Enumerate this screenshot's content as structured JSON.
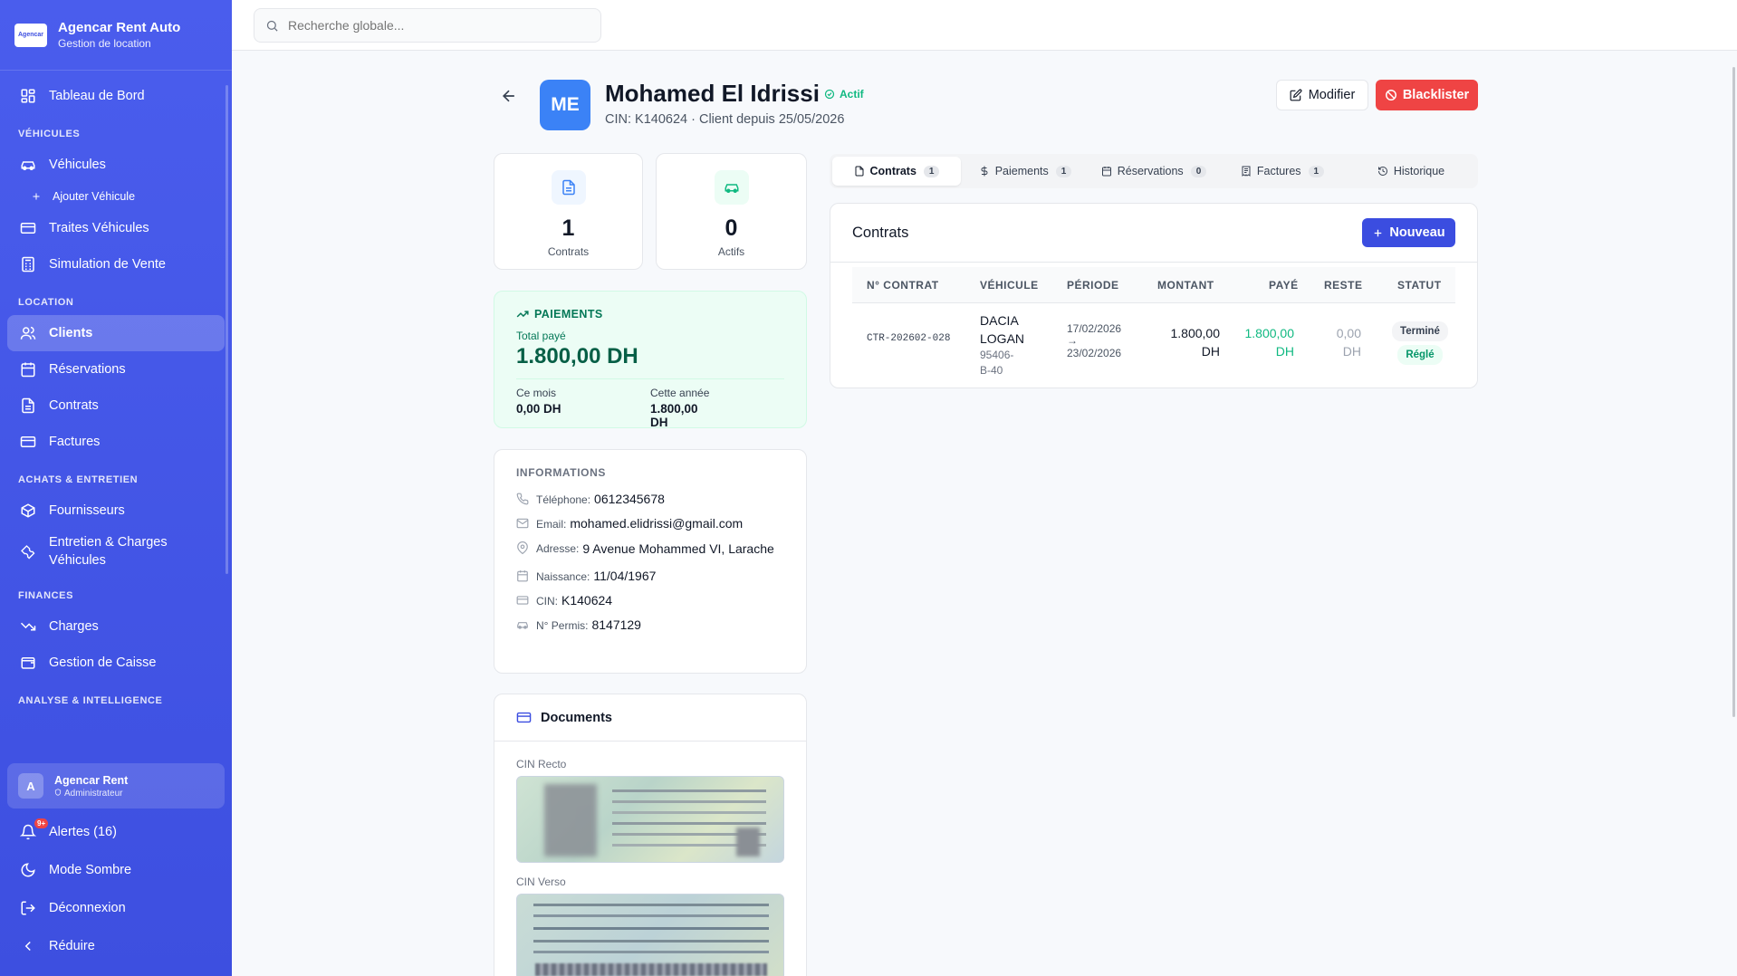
{
  "sidebar": {
    "brand_title": "Agencar Rent Auto",
    "brand_sub": "Gestion de location",
    "logo_text": "Agencar",
    "dashboard": "Tableau de Bord",
    "sec_vehicules": "VÉHICULES",
    "vehicules": "Véhicules",
    "ajouter_vehicule": "Ajouter Véhicule",
    "traites": "Traites Véhicules",
    "simulation": "Simulation de Vente",
    "sec_location": "LOCATION",
    "clients": "Clients",
    "reservations": "Réservations",
    "contrats": "Contrats",
    "factures": "Factures",
    "sec_achats": "ACHATS & ENTRETIEN",
    "fournisseurs": "Fournisseurs",
    "entretien": "Entretien & Charges Véhicules",
    "sec_finances": "FINANCES",
    "charges": "Charges",
    "caisse": "Gestion de Caisse",
    "sec_analyse": "ANALYSE & INTELLIGENCE",
    "user_initial": "A",
    "user_name": "Agencar Rent",
    "user_role": "Administrateur",
    "alerts": "Alertes (16)",
    "alerts_badge": "9+",
    "dark_mode": "Mode Sombre",
    "logout": "Déconnexion",
    "reduce": "Réduire"
  },
  "search": {
    "placeholder": "Recherche globale..."
  },
  "client": {
    "initials": "ME",
    "name": "Mohamed El Idrissi",
    "status": "Actif",
    "subtitle": "CIN: K140624 · Client depuis 25/05/2026",
    "edit_label": "Modifier",
    "blacklist_label": "Blacklister"
  },
  "stats": {
    "contracts_value": "1",
    "contracts_label": "Contrats",
    "active_value": "0",
    "active_label": "Actifs"
  },
  "payments": {
    "title": "PAIEMENTS",
    "total_label": "Total payé",
    "total_value": "1.800,00 DH",
    "month_label": "Ce mois",
    "month_value": "0,00 DH",
    "year_label": "Cette année",
    "year_value": "1.800,00 DH"
  },
  "info": {
    "title": "INFORMATIONS",
    "phone_label": "Téléphone:",
    "phone": "0612345678",
    "email_label": "Email:",
    "email": "mohamed.elidrissi@gmail.com",
    "address_label": "Adresse:",
    "address": "9 Avenue Mohammed VI, Larache",
    "birth_label": "Naissance:",
    "birth": "11/04/1967",
    "cin_label": "CIN:",
    "cin": "K140624",
    "permit_label": "N° Permis:",
    "permit": "8147129"
  },
  "documents": {
    "title": "Documents",
    "recto_label": "CIN Recto",
    "verso_label": "CIN Verso"
  },
  "tabs": [
    {
      "label": "Contrats",
      "count": "1"
    },
    {
      "label": "Paiements",
      "count": "1"
    },
    {
      "label": "Réservations",
      "count": "0"
    },
    {
      "label": "Factures",
      "count": "1"
    },
    {
      "label": "Historique"
    }
  ],
  "contracts": {
    "title": "Contrats",
    "new_label": "Nouveau",
    "columns": [
      "N° CONTRAT",
      "VÉHICULE",
      "PÉRIODE",
      "MONTANT",
      "PAYÉ",
      "RESTE",
      "STATUT"
    ],
    "rows": [
      {
        "number": "CTR-202602-028",
        "vehicle_line1": "DACIA",
        "vehicle_line2": "LOGAN",
        "plate_line1": "95406-",
        "plate_line2": "B-40",
        "period_start": "17/02/2026",
        "period_arrow": "→",
        "period_end": "23/02/2026",
        "amount_line1": "1.800,00",
        "amount_line2": "DH",
        "paid_line1": "1.800,00",
        "paid_line2": "DH",
        "rest_line1": "0,00",
        "rest_line2": "DH",
        "status": "Terminé",
        "payment_status": "Réglé"
      }
    ]
  },
  "colors": {
    "sidebar": "#4a5ded",
    "primary": "#3b4de0",
    "danger": "#ef4444",
    "success": "#10b981",
    "avatar": "#3b82f6"
  }
}
